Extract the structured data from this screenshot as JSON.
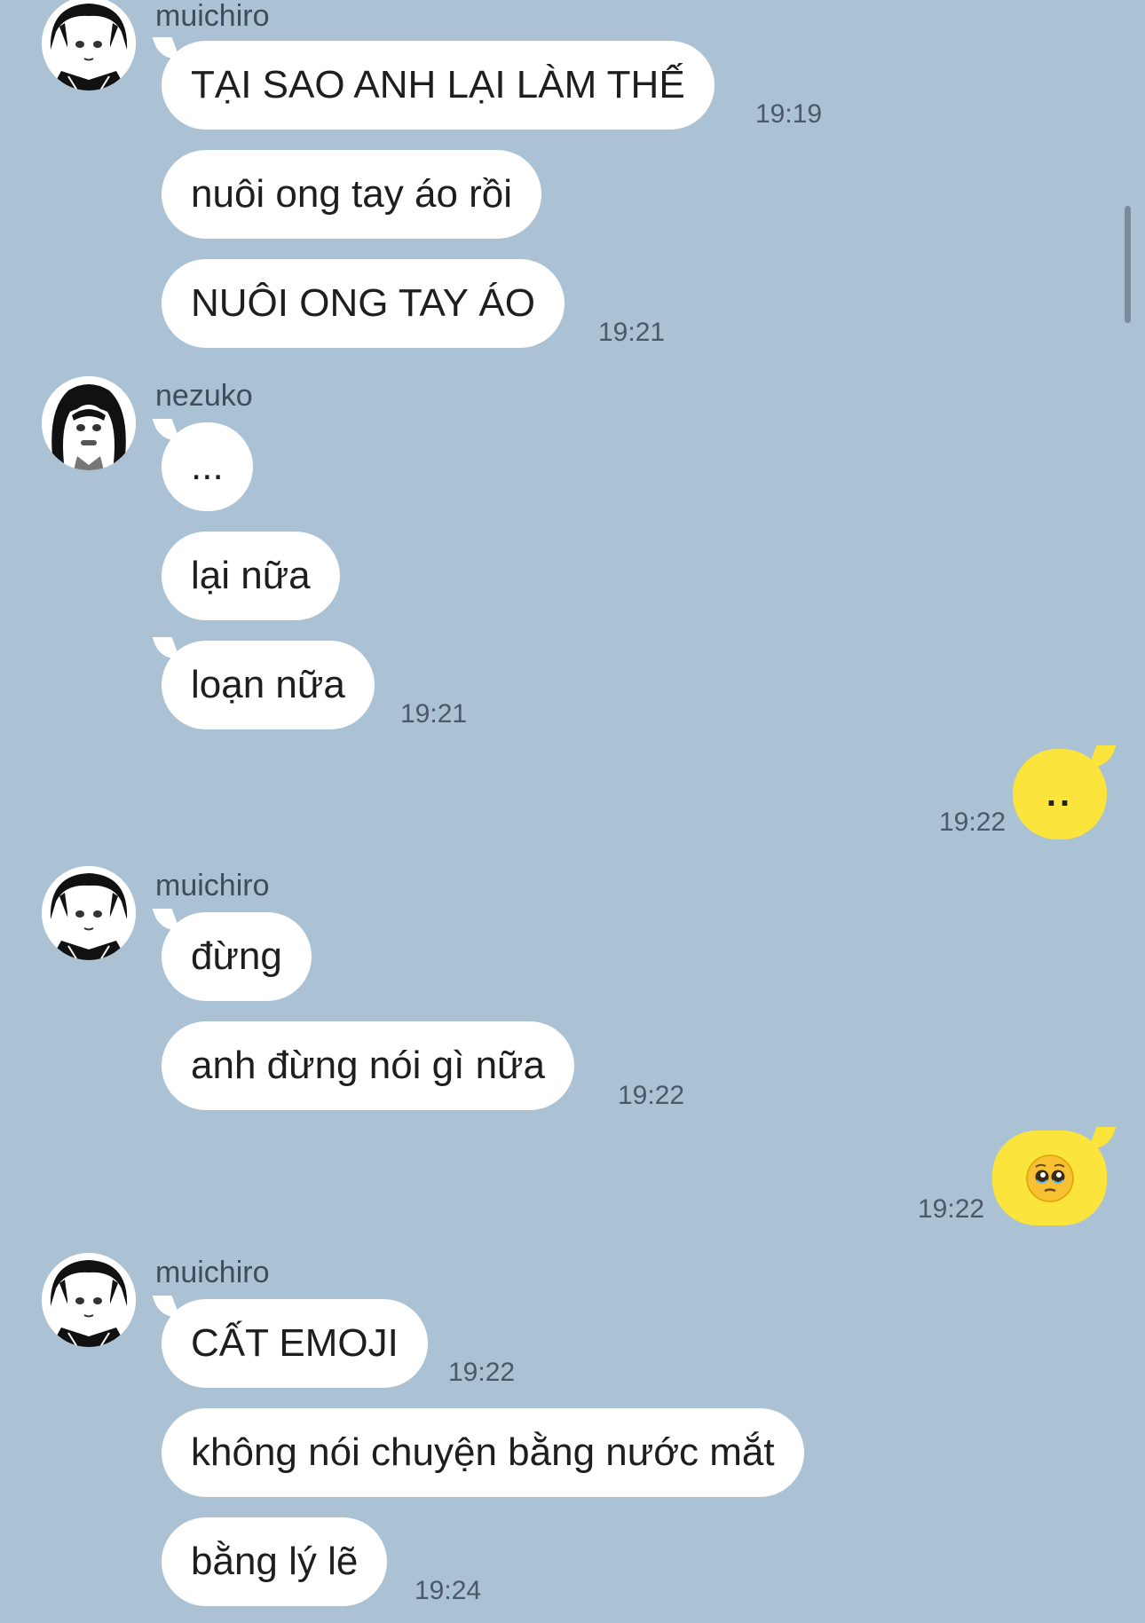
{
  "colors": {
    "background": "#abc1d4",
    "incoming_bubble": "#ffffff",
    "outgoing_bubble": "#fbe53c",
    "timestamp": "#4a5968"
  },
  "senders": {
    "muichiro": "muichiro",
    "nezuko": "nezuko"
  },
  "groups": [
    {
      "sender": "muichiro",
      "messages": [
        "TẠI SAO ANH LẠI LÀM THẾ",
        "nuôi ong tay áo rồi",
        "NUÔI ONG TAY ÁO"
      ],
      "times": [
        "19:19",
        "19:21"
      ]
    },
    {
      "sender": "nezuko",
      "messages": [
        "...",
        "lại nữa",
        "loạn nữa"
      ],
      "times": [
        "19:21"
      ]
    },
    {
      "outgoing": true,
      "message": "..",
      "time": "19:22"
    },
    {
      "sender": "muichiro",
      "messages": [
        "đừng",
        "anh đừng nói gì nữa"
      ],
      "times": [
        "19:22"
      ]
    },
    {
      "outgoing": true,
      "message_icon": "pleading-face-emoji",
      "time": "19:22"
    },
    {
      "sender": "muichiro",
      "messages": [
        "CẤT EMOJI",
        "không nói chuyện bằng nước mắt",
        "bằng lý lẽ"
      ],
      "times": [
        "19:22",
        "19:24"
      ]
    }
  ]
}
